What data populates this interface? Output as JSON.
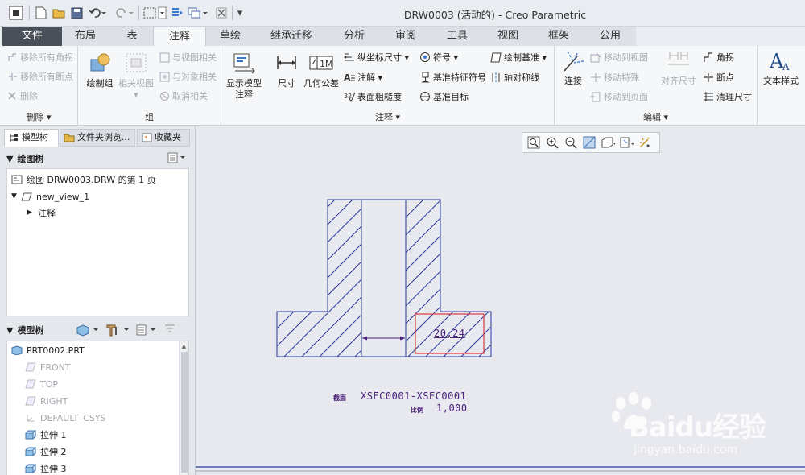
{
  "window": {
    "title": "DRW0003 (活动的) - Creo Parametric"
  },
  "quick_access": {
    "more": "▾"
  },
  "tabs": [
    {
      "label": "文件"
    },
    {
      "label": "布局"
    },
    {
      "label": "表"
    },
    {
      "label": "注释"
    },
    {
      "label": "草绘"
    },
    {
      "label": "继承迁移"
    },
    {
      "label": "分析"
    },
    {
      "label": "审阅"
    },
    {
      "label": "工具"
    },
    {
      "label": "视图"
    },
    {
      "label": "框架"
    },
    {
      "label": "公用"
    }
  ],
  "ribbon": {
    "delete_group": {
      "label": "删除 ▾",
      "items": [
        "移除所有角拐",
        "移除所有断点",
        "删除"
      ]
    },
    "group_group": {
      "label": "组",
      "draw_group": "绘制组",
      "related_view": "相关视图",
      "items": [
        "与视图相关",
        "与对象相关",
        "取消相关"
      ]
    },
    "annot_group": {
      "label": "注释 ▾",
      "show_model": "显示模型\n注释",
      "dimension": "尺寸",
      "gtol": "几何公差",
      "ordinate": "纵坐标尺寸 ▾",
      "note": "注解 ▾",
      "surface_finish": "表面粗糙度",
      "symbol": "符号 ▾",
      "datum_feature": "基准特征符号",
      "datum_target": "基准目标",
      "draw_datum": "绘制基准 ▾",
      "axis_sym": "轴对称线"
    },
    "edit_group": {
      "label": "编辑 ▾",
      "connect": "连接",
      "move_to_view": "移动到视图",
      "move_special": "移动特殊",
      "move_to_page": "移动到页面",
      "align_dim": "对齐尺寸",
      "jog": "角拐",
      "breakpoint": "断点",
      "cleanup": "清理尺寸"
    },
    "text_style": "文本样式"
  },
  "left_panel": {
    "tabs": [
      "模型树",
      "文件夹浏览...",
      "收藏夹"
    ],
    "drawing_tree": {
      "title": "绘图树",
      "rows": [
        {
          "label": "绘图 DRW0003.DRW 的第 1 页"
        },
        {
          "label": "new_view_1"
        },
        {
          "label": "注释"
        }
      ]
    },
    "model_tree": {
      "title": "模型树",
      "rows": [
        {
          "label": "PRT0002.PRT",
          "dim": false
        },
        {
          "label": "FRONT",
          "dim": true
        },
        {
          "label": "TOP",
          "dim": true
        },
        {
          "label": "RIGHT",
          "dim": true
        },
        {
          "label": "DEFAULT_CSYS",
          "dim": true
        },
        {
          "label": "拉伸 1",
          "dim": false
        },
        {
          "label": "拉伸 2",
          "dim": false
        },
        {
          "label": "拉伸 3",
          "dim": false
        }
      ]
    }
  },
  "drawing": {
    "dimension_text": "20,24",
    "section_label": "截面",
    "section_name": "XSEC0001-XSEC0001",
    "scale_label": "比例",
    "scale_value": "1,000"
  },
  "watermark": {
    "brand": "Baidu经验",
    "url": "jingyan.baidu.com"
  },
  "colors": {
    "drawing_line": "#2a3a9a",
    "dimension_box": "#e0393e",
    "dimension_text": "#4a1f7a",
    "file_tab": "#4a5059"
  }
}
